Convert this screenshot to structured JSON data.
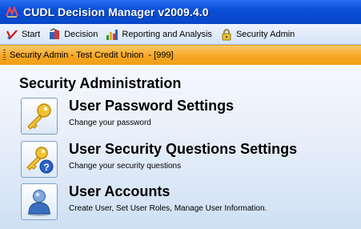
{
  "window": {
    "title": "CUDL Decision Manager v2009.4.0"
  },
  "menu": {
    "items": [
      {
        "label": "Start",
        "icon": "start-icon"
      },
      {
        "label": "Decision",
        "icon": "decision-icon"
      },
      {
        "label": "Reporting and Analysis",
        "icon": "reporting-icon"
      },
      {
        "label": "Security Admin",
        "icon": "lock-icon"
      }
    ]
  },
  "context": {
    "text": "Security Admin - Test Credit Union  - [999]"
  },
  "main": {
    "title": "Security Administration",
    "items": [
      {
        "title": "User Password Settings",
        "description": "Change your password",
        "icon": "key-icon"
      },
      {
        "title": "User Security Questions Settings",
        "description": "Change your security questions",
        "icon": "key-question-icon"
      },
      {
        "title": "User Accounts",
        "description": "Create User, Set User Roles, Manage User Information.",
        "icon": "user-icon"
      }
    ]
  },
  "colors": {
    "titlebar": "#0a4fd8",
    "context_bar": "#f5a623",
    "panel": "#e9f0fa"
  }
}
